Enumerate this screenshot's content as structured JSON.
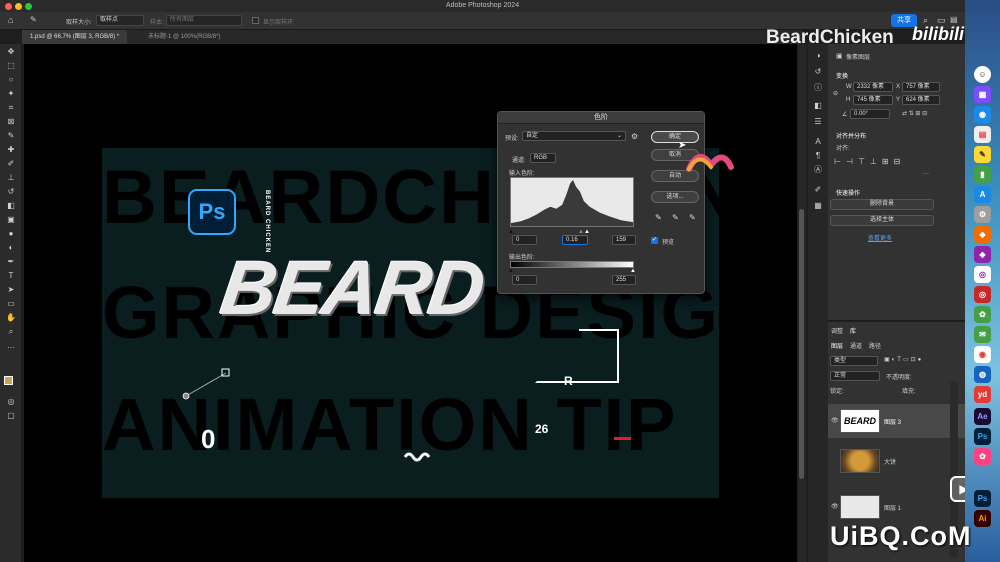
{
  "window": {
    "title": "Adobe Photoshop 2024"
  },
  "options": {
    "sample_size_label": "取样大小:",
    "sample_size_value": "取样点",
    "sample_label": "样本:",
    "sample_value": "所有图层",
    "show_ring_label": "显示取样环",
    "share_label": "共享"
  },
  "tabs": [
    {
      "label": "1.psd @ 66.7% (图层 3, RGB/8) *"
    },
    {
      "label": "未标题-1 @ 100%(RGB/8*)"
    }
  ],
  "canvas": {
    "rows": [
      "BEARDCHICKEN",
      "GRAPHIC DESIGN",
      "ANIMATION TIP"
    ],
    "ps_logo": "Ps",
    "vertical_label": "BEARD CHICKEN",
    "beard_word": "BEARD",
    "left_number": "0",
    "right_number": "26",
    "small_r": "R"
  },
  "levels": {
    "title": "色阶",
    "preset_label": "预设:",
    "preset_value": "自定",
    "channel_label": "通道:",
    "channel_value": "RGB",
    "input_label": "输入色阶:",
    "input_black": "0",
    "input_gamma": "0.16",
    "input_white": "159",
    "output_label": "输出色阶:",
    "output_black": "0",
    "output_white": "255",
    "ok": "确定",
    "cancel": "取消",
    "auto": "自动",
    "options": "选项...",
    "preview": "预览"
  },
  "properties": {
    "layer_type": "像素图层",
    "transform": "变换",
    "w": "W",
    "w_value": "2332 像素",
    "x": "X",
    "x_value": "757 像素",
    "h": "H",
    "h_value": "745 像素",
    "y": "Y",
    "y_value": "624 像素",
    "angle": "0.00°",
    "align_distribute": "对齐并分布",
    "align": "对齐:",
    "quick_actions": "快速操作",
    "remove_bg": "删除背景",
    "select_subject": "选择主体",
    "learn_more": "查看更多"
  },
  "layers_panel": {
    "tab_adjust": "调整",
    "tab_library": "库",
    "subtab_layers": "图层",
    "subtab_channels": "通道",
    "subtab_paths": "路径",
    "kind": "类型",
    "blend": "正常",
    "opacity_label": "不透明度:",
    "lock_label": "锁定:",
    "fill_label": "填充:",
    "items": [
      {
        "name": "图层 3",
        "thumb": "BEARD"
      },
      {
        "name": "大饼",
        "thumb": ""
      },
      {
        "name": "图层 1",
        "thumb": ""
      }
    ]
  },
  "watermarks": {
    "channel": "BeardChicken",
    "site": "bilibili",
    "uibq": "UiBQ.CoM"
  },
  "dock_icons": [
    "Ae",
    "yd",
    "Ps",
    "Ai"
  ]
}
